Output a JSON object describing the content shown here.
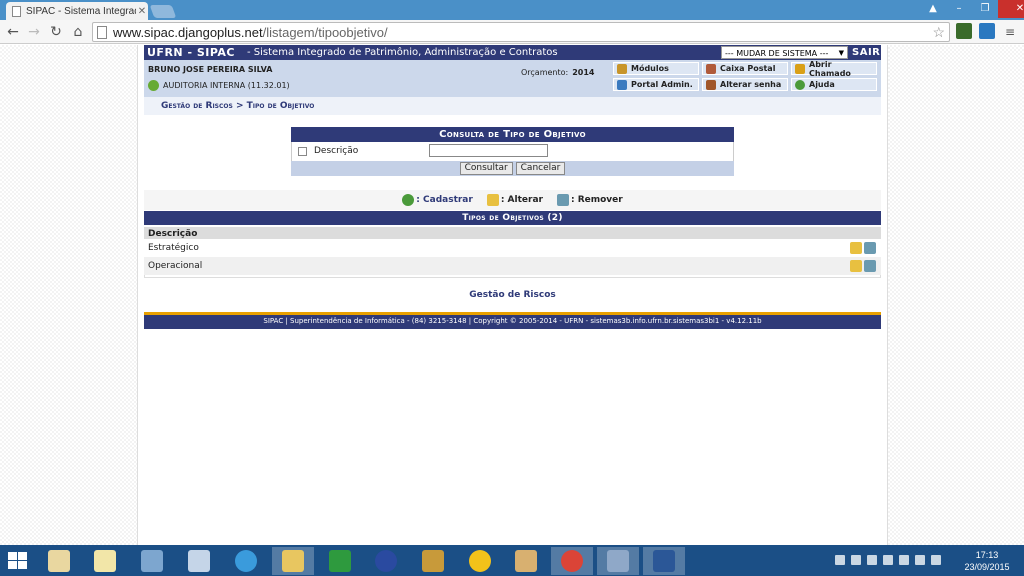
{
  "browser": {
    "tab_title": "SIPAC - Sistema Integrado",
    "url_host": "www.sipac.djangoplus.net",
    "url_path": "/listagem/tipoobjetivo/"
  },
  "system_bar": {
    "name": "UFRN - SIPAC",
    "description": "- Sistema Integrado de Patrimônio, Administração e Contratos",
    "select_value": "--- MUDAR DE SISTEMA ---",
    "exit_label": "SAIR"
  },
  "user": {
    "name": "BRUNO JOSE PEREIRA SILVA",
    "unit": "AUDITORIA INTERNA (11.32.01)",
    "budget_label": "Orçamento:",
    "budget_year": "2014"
  },
  "quick_links": [
    {
      "label": "Módulos",
      "color": "#c8952a"
    },
    {
      "label": "Caixa Postal",
      "color": "#b05a3a"
    },
    {
      "label": "Abrir Chamado",
      "color": "#d9a018"
    },
    {
      "label": "Portal Admin.",
      "color": "#3a7abf"
    },
    {
      "label": "Alterar senha",
      "color": "#a0562a"
    },
    {
      "label": "Ajuda",
      "color": "#4a9a3a"
    }
  ],
  "breadcrumb": "Gestão de Riscos > Tipo de Objetivo",
  "search_form": {
    "caption": "Consulta de Tipo de Objetivo",
    "field_label": "Descrição",
    "field_value": "",
    "submit_label": "Consultar",
    "cancel_label": "Cancelar"
  },
  "legend": {
    "add_label": ": Cadastrar",
    "edit_label": ": Alterar",
    "remove_label": ": Remover"
  },
  "list": {
    "caption": "Tipos de Objetivos (2)",
    "column": "Descrição",
    "rows": [
      "Estratégico",
      "Operacional"
    ]
  },
  "footer_link": "Gestão de Riscos",
  "footer_text": "SIPAC | Superintendência de Informática - (84) 3215-3148 | Copyright © 2005-2014 - UFRN - sistemas3b.info.ufrn.br.sistemas3bi1 - v4.12.11b",
  "taskbar": {
    "time": "17:13",
    "date": "23/09/2015"
  },
  "colors": {
    "brand": "#2f3a78",
    "accent": "#e8a000"
  }
}
